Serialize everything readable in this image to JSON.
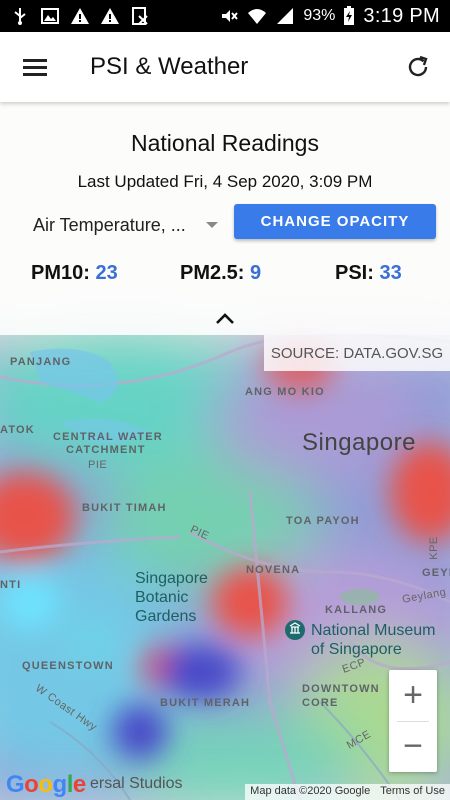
{
  "status_bar": {
    "battery_percent": "93%",
    "time": "3:19 PM",
    "icons": [
      "usb-icon",
      "gallery-icon",
      "warning-icon",
      "warning-icon",
      "exchange-icon",
      "mute-icon",
      "wifi-icon",
      "signal-icon",
      "battery-icon"
    ]
  },
  "appbar": {
    "title": "PSI & Weather",
    "menu_icon": "hamburger-menu-icon",
    "refresh_icon": "refresh-icon"
  },
  "panel": {
    "title": "National Readings",
    "updated": "Last Updated Fri, 4 Sep 2020, 3:09 PM",
    "dropdown_value": "Air Temperature, ...",
    "opacity_button": "CHANGE OPACITY",
    "readings": [
      {
        "label": "PM10:",
        "value": "23"
      },
      {
        "label": "PM2.5:",
        "value": "9"
      },
      {
        "label": "PSI:",
        "value": "33"
      }
    ],
    "collapse_icon": "chevron-up-icon"
  },
  "source": "SOURCE: DATA.GOV.SG",
  "map": {
    "labels": {
      "panjang": "PANJANG",
      "ang_mo_kio": "ANG MO KIO",
      "atok": "ATOK",
      "central_water": "CENTRAL WATER",
      "catchment": "CATCHMENT",
      "pie1": "PIE",
      "singapore": "Singapore",
      "bukit_timah": "BUKIT TIMAH",
      "pie2": "PIE",
      "toa_payoh": "TOA PAYOH",
      "nti": "NTI",
      "novena": "NOVENA",
      "botanic": "Singapore Botanic Gardens",
      "kallang": "KALLANG",
      "museum": "National Museum of Singapore",
      "queenstown": "QUEENSTOWN",
      "ecp": "ECP",
      "w_coast_hwy": "W Coast Hwy",
      "downtown_core": "DOWNTOWN CORE",
      "bukit_merah": "BUKIT MERAH",
      "mce": "MCE",
      "studios": "ersal Studios",
      "kpe": "KPE",
      "geyla": "GEYLA",
      "geylang": "Geylang"
    }
  },
  "zoom": {
    "in": "+",
    "out": "−"
  },
  "google": "Google",
  "attribution": {
    "map_data": "Map data ©2020 Google",
    "terms": "Terms of Use"
  },
  "colors": {
    "accent": "#3a7bea",
    "value_blue": "#3a6fd6"
  }
}
